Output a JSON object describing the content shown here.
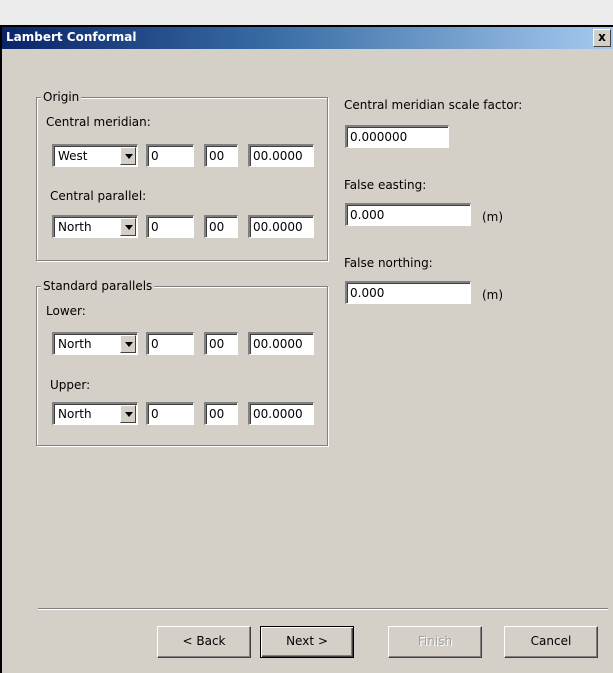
{
  "window": {
    "title": "Lambert Conformal",
    "close_label": "x"
  },
  "origin": {
    "group_title": "Origin",
    "central_meridian": {
      "label": "Central meridian:",
      "direction": "West",
      "deg": "0",
      "min": "00",
      "sec": "00.0000"
    },
    "central_parallel": {
      "label": "Central parallel:",
      "direction": "North",
      "deg": "0",
      "min": "00",
      "sec": "00.0000"
    }
  },
  "standard_parallels": {
    "group_title": "Standard parallels",
    "lower": {
      "label": "Lower:",
      "direction": "North",
      "deg": "0",
      "min": "00",
      "sec": "00.0000"
    },
    "upper": {
      "label": "Upper:",
      "direction": "North",
      "deg": "0",
      "min": "00",
      "sec": "00.0000"
    }
  },
  "right_panel": {
    "scale_factor": {
      "label": "Central meridian scale factor:",
      "value": "0.000000"
    },
    "false_easting": {
      "label": "False easting:",
      "value": "0.000",
      "unit": "(m)"
    },
    "false_northing": {
      "label": "False northing:",
      "value": "0.000",
      "unit": "(m)"
    }
  },
  "buttons": {
    "back": "< Back",
    "next": "Next >",
    "finish": "Finish",
    "cancel": "Cancel"
  }
}
